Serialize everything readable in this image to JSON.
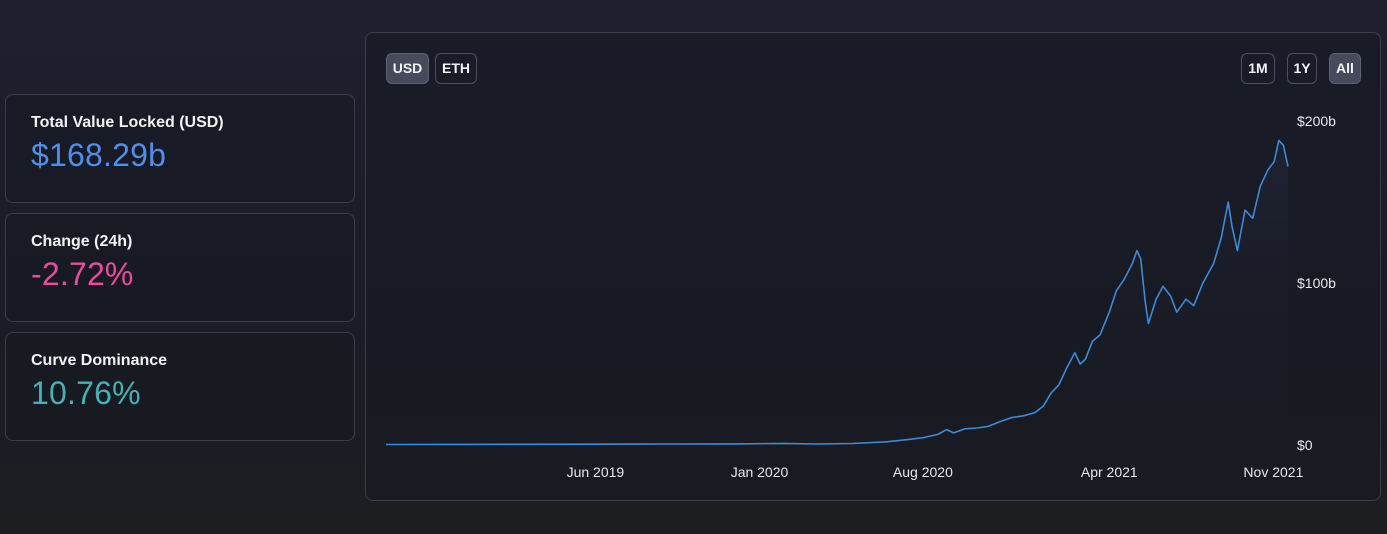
{
  "stats": [
    {
      "label": "Total Value Locked (USD)",
      "value": "$168.29b",
      "color": "#4f8fe8"
    },
    {
      "label": "Change (24h)",
      "value": "-2.72%",
      "color": "#ea4aa0"
    },
    {
      "label": "Curve Dominance",
      "value": "10.76%",
      "color": "#46b0b5"
    }
  ],
  "toolbar": {
    "currency": [
      {
        "label": "USD",
        "active": true
      },
      {
        "label": "ETH",
        "active": false
      }
    ],
    "range": [
      {
        "label": "1M",
        "active": false
      },
      {
        "label": "1Y",
        "active": false
      },
      {
        "label": "All",
        "active": true
      }
    ]
  },
  "chart_data": {
    "type": "line",
    "line_color": "#3b8bd9",
    "x_tick_labels": [
      "Jun 2019",
      "Jan 2020",
      "Aug 2020",
      "Apr 2021",
      "Nov 2021"
    ],
    "y_tick_labels": [
      "$0",
      "$100b",
      "$200b"
    ],
    "ylim": [
      0,
      200
    ],
    "x_range": [
      "2018-09-01",
      "2021-11-20"
    ],
    "grid": false,
    "series": [
      {
        "values": [
          [
            "2018-09-01",
            0.3
          ],
          [
            "2018-12-01",
            0.35
          ],
          [
            "2019-03-01",
            0.45
          ],
          [
            "2019-06-01",
            0.5
          ],
          [
            "2019-09-01",
            0.6
          ],
          [
            "2019-12-01",
            0.7
          ],
          [
            "2020-02-01",
            1.0
          ],
          [
            "2020-03-15",
            0.6
          ],
          [
            "2020-05-01",
            0.9
          ],
          [
            "2020-06-15",
            2.0
          ],
          [
            "2020-07-15",
            3.5
          ],
          [
            "2020-08-01",
            4.5
          ],
          [
            "2020-08-20",
            6.5
          ],
          [
            "2020-09-01",
            9.5
          ],
          [
            "2020-09-10",
            7.5
          ],
          [
            "2020-09-25",
            10.0
          ],
          [
            "2020-10-10",
            10.5
          ],
          [
            "2020-10-25",
            11.5
          ],
          [
            "2020-11-10",
            14.5
          ],
          [
            "2020-11-25",
            17.0
          ],
          [
            "2020-12-10",
            18.0
          ],
          [
            "2020-12-25",
            20.0
          ],
          [
            "2021-01-05",
            24.0
          ],
          [
            "2021-01-15",
            32.0
          ],
          [
            "2021-01-25",
            37.0
          ],
          [
            "2021-02-05",
            48.0
          ],
          [
            "2021-02-15",
            57.0
          ],
          [
            "2021-02-22",
            50.0
          ],
          [
            "2021-03-01",
            53.0
          ],
          [
            "2021-03-10",
            64.0
          ],
          [
            "2021-03-20",
            68.0
          ],
          [
            "2021-04-01",
            82.0
          ],
          [
            "2021-04-10",
            95.0
          ],
          [
            "2021-04-20",
            102.0
          ],
          [
            "2021-05-01",
            112.0
          ],
          [
            "2021-05-07",
            120.0
          ],
          [
            "2021-05-12",
            115.0
          ],
          [
            "2021-05-18",
            88.0
          ],
          [
            "2021-05-22",
            75.0
          ],
          [
            "2021-06-01",
            90.0
          ],
          [
            "2021-06-10",
            98.0
          ],
          [
            "2021-06-20",
            92.0
          ],
          [
            "2021-06-28",
            82.0
          ],
          [
            "2021-07-10",
            90.0
          ],
          [
            "2021-07-20",
            86.0
          ],
          [
            "2021-08-01",
            100.0
          ],
          [
            "2021-08-15",
            112.0
          ],
          [
            "2021-08-25",
            128.0
          ],
          [
            "2021-09-03",
            150.0
          ],
          [
            "2021-09-08",
            135.0
          ],
          [
            "2021-09-15",
            120.0
          ],
          [
            "2021-09-25",
            145.0
          ],
          [
            "2021-10-05",
            140.0
          ],
          [
            "2021-10-15",
            160.0
          ],
          [
            "2021-10-25",
            170.0
          ],
          [
            "2021-11-02",
            175.0
          ],
          [
            "2021-11-08",
            188.0
          ],
          [
            "2021-11-14",
            185.0
          ],
          [
            "2021-11-20",
            172.0
          ]
        ]
      }
    ]
  }
}
